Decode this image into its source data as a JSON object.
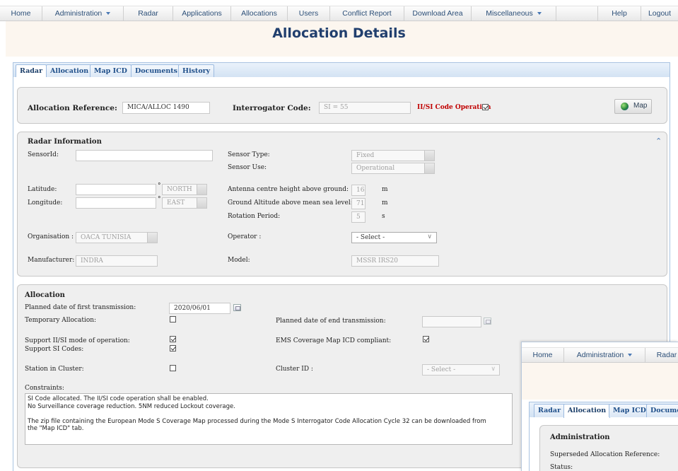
{
  "nav": {
    "items": [
      "Home",
      "Administration",
      "Radar",
      "Applications",
      "Allocations",
      "Users",
      "Conflict Report",
      "Download Area",
      "Miscellaneous",
      "Help",
      "Logout"
    ]
  },
  "page": {
    "title": "Allocation Details"
  },
  "tabs": [
    "Radar",
    "Allocation",
    "Map ICD",
    "Documents",
    "History"
  ],
  "top": {
    "allocation_reference_label": "Allocation Reference:",
    "allocation_reference_value": "MICA/ALLOC 1490",
    "interrogator_code_label": "Interrogator Code:",
    "interrogator_code_value": "SI = 55",
    "iisi_label": "II/SI Code Operation",
    "iisi_checked": true,
    "map_button": "Map"
  },
  "radar_info": {
    "title": "Radar Information",
    "sensorid_label": "SensorId:",
    "sensorid_value": "",
    "sensor_type_label": "Sensor Type:",
    "sensor_type_value": "Fixed",
    "sensor_use_label": "Sensor Use:",
    "sensor_use_value": "Operational",
    "latitude_label": "Latitude:",
    "latitude_dir": "NORTH",
    "longitude_label": "Longitude:",
    "longitude_dir": "EAST",
    "degree_mark": "°",
    "antenna_label": "Antenna centre height above ground:",
    "antenna_value": "16",
    "antenna_unit": "m",
    "ground_label": "Ground Altitude above mean sea level:",
    "ground_value": "71",
    "ground_unit": "m",
    "rotation_label": "Rotation Period:",
    "rotation_value": "5",
    "rotation_unit": "s",
    "organisation_label": "Organisation :",
    "organisation_value": "OACA TUNISIA",
    "operator_label": "Operator :",
    "operator_value": "- Select -",
    "manufacturer_label": "Manufacturer:",
    "manufacturer_value": "INDRA",
    "model_label": "Model:",
    "model_value": "MSSR IRS20"
  },
  "allocation": {
    "title": "Allocation",
    "planned_first_label": "Planned date of first transmission:",
    "planned_first_value": "2020/06/01",
    "temporary_label": "Temporary Allocation:",
    "temporary_checked": false,
    "planned_end_label": "Planned date of end transmission:",
    "planned_end_value": "",
    "support_iisi_label": "Support II/SI mode of operation:",
    "support_iisi_checked": true,
    "support_si_label": "Support SI Codes:",
    "support_si_checked": true,
    "ems_label": "EMS Coverage Map ICD compliant:",
    "ems_checked": true,
    "station_cluster_label": "Station in Cluster:",
    "station_cluster_checked": false,
    "cluster_id_label": "Cluster ID :",
    "cluster_id_value": "- Select -",
    "constraints_label": "Constraints:",
    "constraints_text": "SI Code allocated. The II/SI code operation shall be enabled.\nNo Surveillance coverage reduction. 5NM reduced Lockout coverage.\n\nThe zip file containing the European Mode S Coverage Map processed during the Mode S Interrogator Code Allocation Cycle 32 can be downloaded from\nthe \"Map ICD\" tab."
  },
  "overlay": {
    "nav_items": [
      "Home",
      "Administration",
      "Radar"
    ],
    "tabs": [
      "Radar",
      "Allocation",
      "Map ICD",
      "Docume"
    ],
    "section_title": "Administration",
    "superseded_label": "Superseded Allocation Reference:",
    "status_label": "Status:"
  },
  "colors": {
    "accent": "#213f6e",
    "link": "#2c4f78",
    "warning": "#c00000",
    "header_bg": "#fcf6ef"
  }
}
